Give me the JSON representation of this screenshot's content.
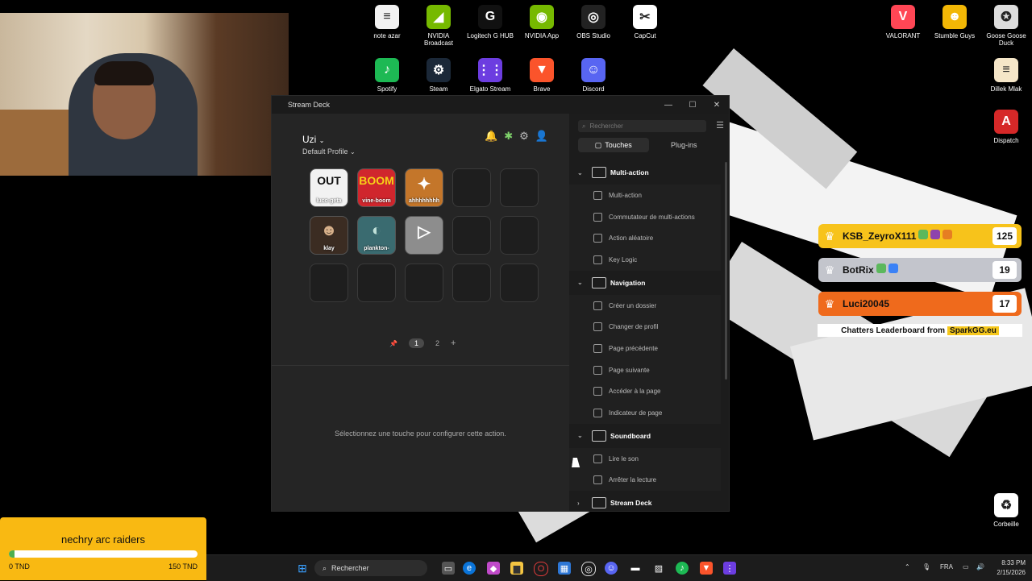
{
  "desktop_icons": [
    {
      "label": "note azar",
      "icon": "document-icon",
      "glyph": "≡",
      "color": "#f2f2f2"
    },
    {
      "label": "NVIDIA Broadcast",
      "icon": "nvidia-broadcast-icon",
      "glyph": "◢",
      "color": "#76b900"
    },
    {
      "label": "Logitech G HUB",
      "icon": "logitech-icon",
      "glyph": "G",
      "color": "#111111"
    },
    {
      "label": "NVIDIA App",
      "icon": "nvidia-icon",
      "glyph": "◉",
      "color": "#76b900"
    },
    {
      "label": "OBS Studio",
      "icon": "obs-icon",
      "glyph": "◎",
      "color": "#222222"
    },
    {
      "label": "CapCut",
      "icon": "capcut-icon",
      "glyph": "✂",
      "color": "#ffffff"
    },
    {
      "label": "Spotify",
      "icon": "spotify-icon",
      "glyph": "♪",
      "color": "#1db954"
    },
    {
      "label": "Steam",
      "icon": "steam-icon",
      "glyph": "⚙",
      "color": "#1b2838"
    },
    {
      "label": "Elgato Stream",
      "icon": "elgato-icon",
      "glyph": "⋮⋮",
      "color": "#6c3de0"
    },
    {
      "label": "Brave",
      "icon": "brave-icon",
      "glyph": "▼",
      "color": "#fb542b"
    },
    {
      "label": "Discord",
      "icon": "discord-icon",
      "glyph": "☺",
      "color": "#5865f2"
    },
    {
      "label": "VALORANT",
      "icon": "valorant-icon",
      "glyph": "V",
      "color": "#ff4655"
    },
    {
      "label": "Stumble Guys",
      "icon": "stumble-guys-icon",
      "glyph": "☻",
      "color": "#f2b705"
    },
    {
      "label": "Goose Goose Duck",
      "icon": "goose-duck-icon",
      "glyph": "✪",
      "color": "#dddddd"
    },
    {
      "label": "Dillek Mlak",
      "icon": "document-arabic-icon",
      "glyph": "≡",
      "color": "#f5e6c8"
    },
    {
      "label": "Dispatch",
      "icon": "dispatch-icon",
      "glyph": "A",
      "color": "#d62828"
    },
    {
      "label": "Corbeille",
      "icon": "recycle-bin-icon",
      "glyph": "♻",
      "color": "#ffffff"
    }
  ],
  "streamdeck": {
    "window_title": "Stream Deck",
    "window_controls": {
      "minimize": "—",
      "maximize": "☐",
      "close": "✕"
    },
    "profile_name": "Uzi",
    "profile_sub": "Default Profile",
    "keys": [
      {
        "label": "luco-geta",
        "glyph": "OUT",
        "bg": "#f2f2f2",
        "fg": "#111111"
      },
      {
        "label": "vine-boom",
        "glyph": "BOOM",
        "bg": "#d0262d",
        "fg": "#f7d117"
      },
      {
        "label": "ahhhhhhhh",
        "glyph": "✦",
        "bg": "#c4762a",
        "fg": "#ffffff"
      },
      {
        "label": "",
        "glyph": "",
        "bg": "#1e1e1e",
        "fg": "#ffffff"
      },
      {
        "label": "",
        "glyph": "",
        "bg": "#1e1e1e",
        "fg": "#ffffff"
      },
      {
        "label": "klay",
        "glyph": "☻",
        "bg": "#3b2c22",
        "fg": "#d7b08a"
      },
      {
        "label": "plankton-",
        "glyph": "◐",
        "bg": "#3a6b70",
        "fg": "#bfe0d8"
      },
      {
        "label": "",
        "glyph": "▷",
        "bg": "#8d8d8d",
        "fg": "#ffffff"
      },
      {
        "label": "",
        "glyph": "",
        "bg": "#1e1e1e",
        "fg": "#ffffff"
      },
      {
        "label": "",
        "glyph": "",
        "bg": "#1e1e1e",
        "fg": "#ffffff"
      },
      {
        "label": "",
        "glyph": "",
        "bg": "#1e1e1e",
        "fg": "#ffffff"
      },
      {
        "label": "",
        "glyph": "",
        "bg": "#1e1e1e",
        "fg": "#ffffff"
      },
      {
        "label": "",
        "glyph": "",
        "bg": "#1e1e1e",
        "fg": "#ffffff"
      },
      {
        "label": "",
        "glyph": "",
        "bg": "#1e1e1e",
        "fg": "#ffffff"
      },
      {
        "label": "",
        "glyph": "",
        "bg": "#1e1e1e",
        "fg": "#ffffff"
      }
    ],
    "pages": {
      "pin": "📌",
      "page1": "1",
      "page2": "2",
      "add": "+"
    },
    "hint": "Sélectionnez une touche pour configurer cette action.",
    "search_placeholder": "Rechercher",
    "tabs": [
      "Touches",
      "Plug-ins"
    ],
    "categories": [
      {
        "name": "Multi-action",
        "actions": [
          "Multi-action",
          "Commutateur de multi-actions",
          "Action aléatoire",
          "Key Logic"
        ]
      },
      {
        "name": "Navigation",
        "actions": [
          "Créer un dossier",
          "Changer de profil",
          "Page précédente",
          "Page suivante",
          "Accéder à la page",
          "Indicateur de page"
        ]
      },
      {
        "name": "Soundboard",
        "actions": [
          "Lire le son",
          "Arrêter la lecture"
        ]
      },
      {
        "name": "Stream Deck",
        "actions": []
      }
    ]
  },
  "leaderboard": {
    "rows": [
      {
        "name": "KSB_ZeyroX111",
        "score": "125",
        "color": "#f7c31b"
      },
      {
        "name": "BotRix",
        "score": "19",
        "color": "#c3c5cc"
      },
      {
        "name": "Luci20045",
        "score": "17",
        "color": "#ef6a1c"
      }
    ],
    "footer": "Chatters Leaderboard from",
    "brand": "SparkGG.eu"
  },
  "donation_goal": {
    "title": "nechry arc raiders",
    "min": "0 TND",
    "max": "150 TND",
    "progress": 0.03
  },
  "taskbar": {
    "search": "Rechercher",
    "lang": "FRA",
    "time": "8:33 PM",
    "date": "2/15/2026"
  }
}
